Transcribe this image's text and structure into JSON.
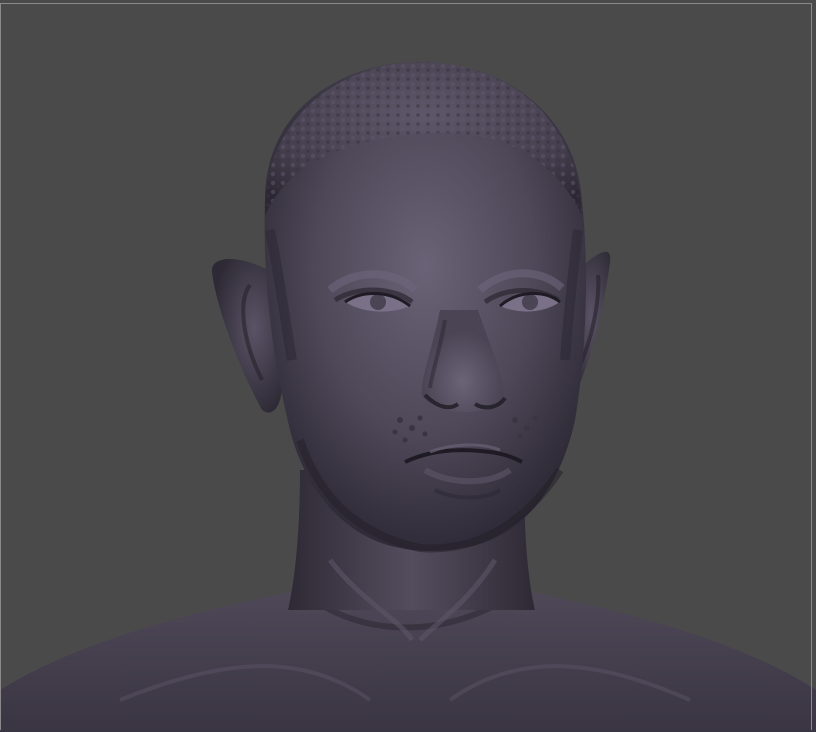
{
  "viewport": {
    "background_color": "#4a4a4a",
    "border_color": "#8a8a8a",
    "model_material_color": "#4e4858",
    "model_highlight_color": "#7a7088",
    "model_shadow_color": "#1e1b24",
    "subject": "sculpted-bust-icon"
  }
}
